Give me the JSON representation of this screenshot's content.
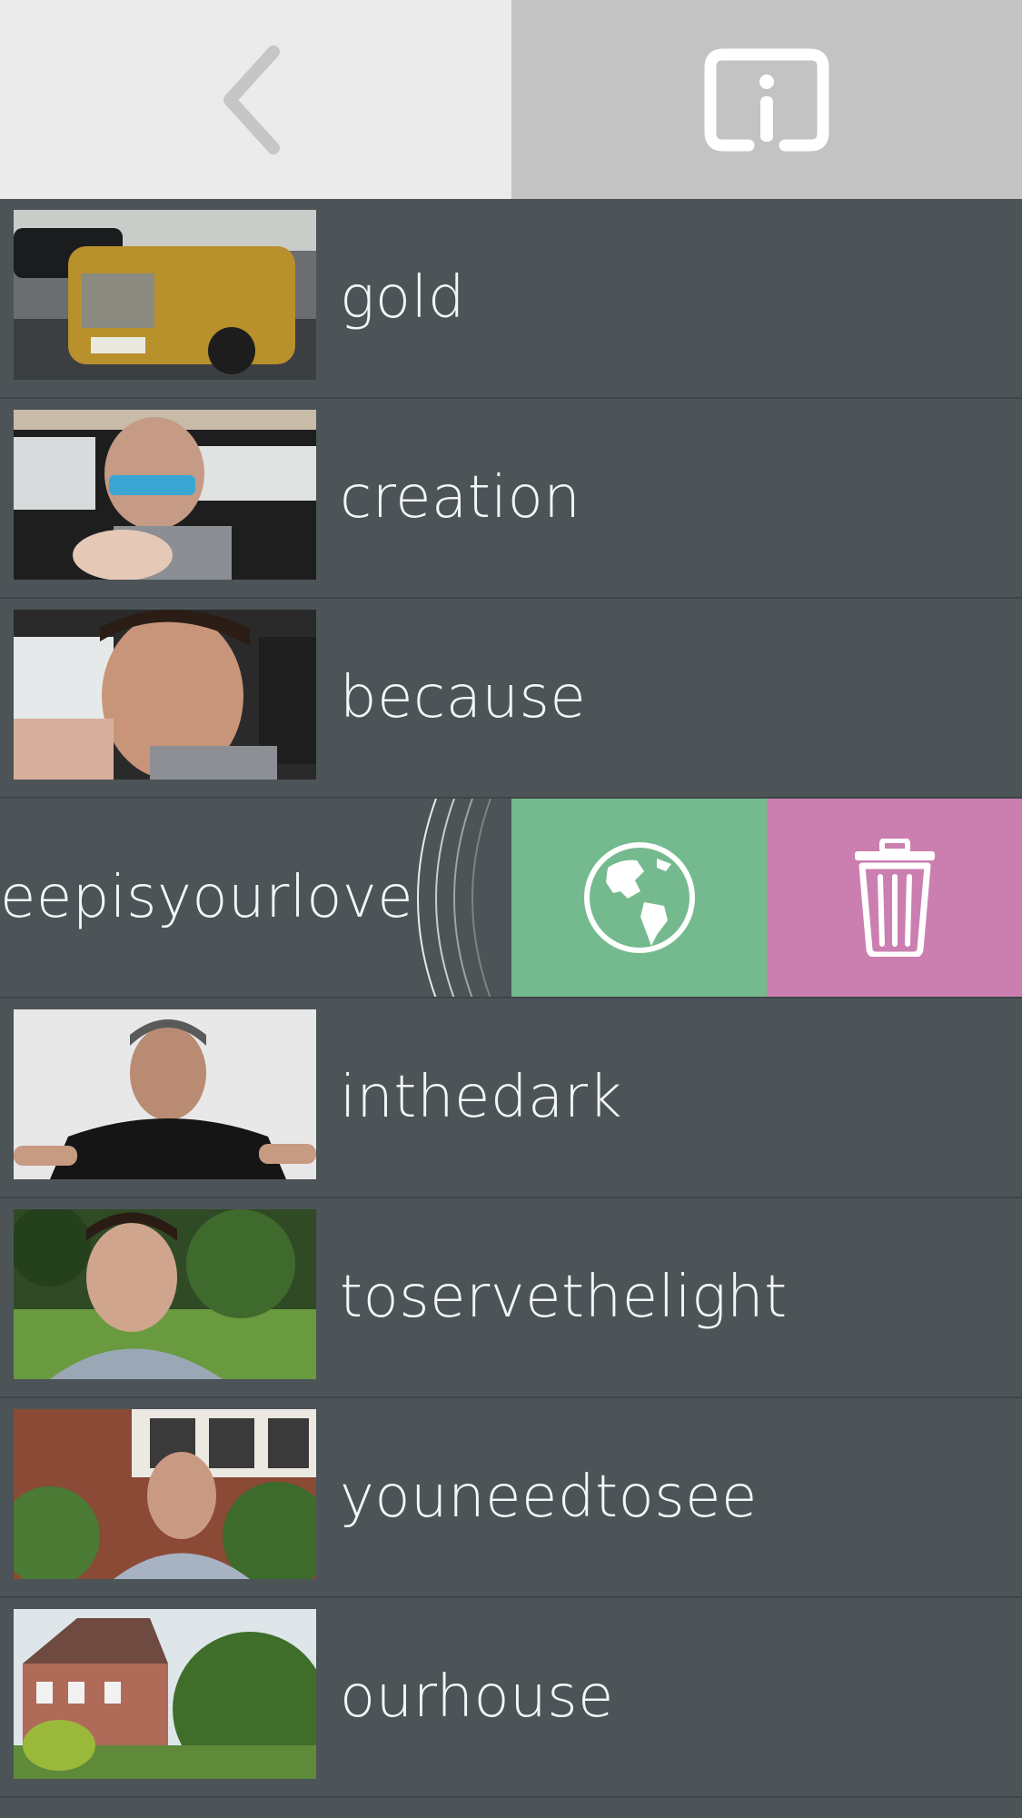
{
  "toolbar": {
    "back_icon": "chevron-left-icon",
    "info_icon": "info-icon"
  },
  "videos": [
    {
      "label": "gold",
      "thumbnail": "gold car"
    },
    {
      "label": "creation",
      "thumbnail": "man in car holding bottle"
    },
    {
      "label": "because",
      "thumbnail": "man selfie in car"
    },
    {
      "label": "eepisyourlove",
      "thumbnail": "",
      "swiped": true
    },
    {
      "label": "inthedark",
      "thumbnail": "man in black shirt"
    },
    {
      "label": "toservethelight",
      "thumbnail": "man in garden"
    },
    {
      "label": "youneedtosee",
      "thumbnail": "man in front of house"
    },
    {
      "label": "ourhouse",
      "thumbnail": "brick house with garden"
    }
  ],
  "swipe_actions": {
    "publish_icon": "globe-icon",
    "delete_icon": "trash-icon",
    "publish_color": "#74ba8e",
    "delete_color": "#cb7fb0"
  }
}
